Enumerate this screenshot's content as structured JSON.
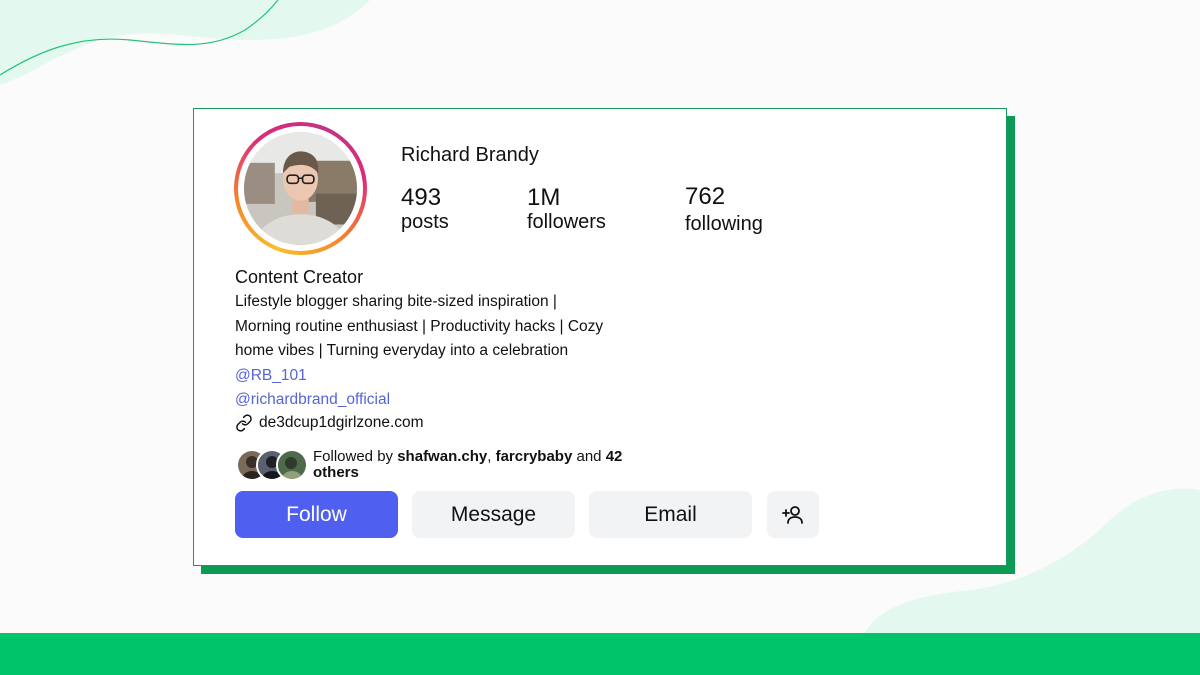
{
  "profile": {
    "name": "Richard Brandy",
    "stats": [
      {
        "value": "493",
        "label": "posts"
      },
      {
        "value": "1M",
        "label": "followers"
      },
      {
        "value": "762",
        "label": "following"
      }
    ],
    "category": "Content Creator",
    "bio_lines": [
      "Lifestyle blogger sharing bite-sized inspiration |",
      "Morning routine enthusiast | Productivity hacks | Cozy",
      "home vibes | Turning everyday into a celebration"
    ],
    "handles": [
      "@RB_101",
      "@richardbrand_official"
    ],
    "website": "de3dcup1dgirlzone.com",
    "followed_by": {
      "prefix": "Followed by ",
      "user1": "shafwan.chy",
      "separator": ", ",
      "user2": "farcrybaby",
      "middle": " and ",
      "count": "42",
      "suffix": "others"
    }
  },
  "buttons": {
    "follow": "Follow",
    "message": "Message",
    "email": "Email",
    "add_user_icon": "add-user-icon"
  },
  "colors": {
    "accent": "#4f5ff0",
    "link": "#5664d6",
    "brand_green": "#00c46a",
    "card_shadow": "#0c9b55",
    "button_bg": "#f1f3f5"
  }
}
